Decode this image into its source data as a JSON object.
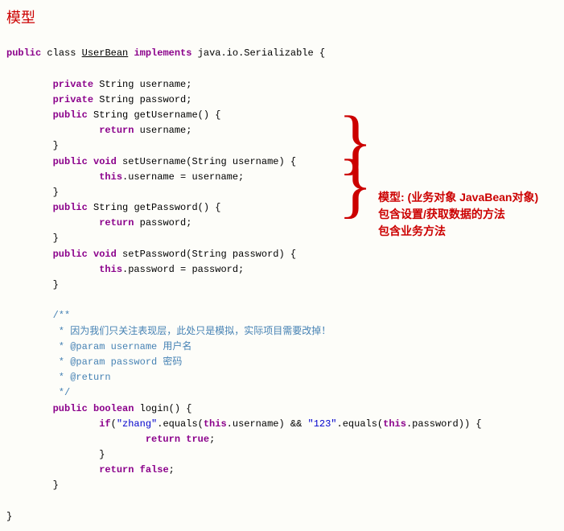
{
  "title": "模型",
  "code": {
    "l1a": "public",
    "l1b": " class ",
    "l1c": "UserBean",
    "l1d": " implements",
    "l1e": " java.io.Serializable {",
    "l2a": "private",
    "l2b": " String ",
    "l2c": "username",
    "l2d": ";",
    "l3a": "private",
    "l3b": " String ",
    "l3c": "password",
    "l3d": ";",
    "l4a": "public",
    "l4b": " String getUsername() {",
    "l5a": "return",
    "l5b": " username",
    "l5c": ";",
    "l6": "}",
    "l7a": "public",
    "l7b": " void",
    "l7c": " setUsername(String username) {",
    "l8a": "this",
    "l8b": ".",
    "l8c": "username",
    "l8d": " = username;",
    "l9": "}",
    "l10a": "public",
    "l10b": " String getPassword() {",
    "l11a": "return",
    "l11b": " password",
    "l11c": ";",
    "l12": "}",
    "l13a": "public",
    "l13b": " void",
    "l13c": " setPassword(String password) {",
    "l14a": "this",
    "l14b": ".",
    "l14c": "password",
    "l14d": " = password;",
    "l15": "}",
    "c1": "/**",
    "c2": " * 因为我们只关注表现层，此处只是模拟，实际项目需要改掉！",
    "c3": " * @param username 用户名",
    "c4": " * @param password 密码",
    "c5": " * @return",
    "c6": " */",
    "l16a": "public",
    "l16b": " boolean",
    "l16c": " login() {",
    "l17a": "if",
    "l17b": "(",
    "l17c": "\"zhang\"",
    "l17d": ".equals(",
    "l17e": "this",
    "l17f": ".",
    "l17g": "username",
    "l17h": ") && ",
    "l17i": "\"123\"",
    "l17j": ".equals(",
    "l17k": "this",
    "l17l": ".",
    "l17m": "password",
    "l17n": ")) {",
    "l18a": "return",
    "l18b": " true",
    "l18c": ";",
    "l19": "}",
    "l20a": "return",
    "l20b": " false",
    "l20c": ";",
    "l21": "}",
    "l22": "}"
  },
  "annotation": {
    "line1": "模型: (业务对象 JavaBean对象)",
    "line2": "包含设置/获取数据的方法",
    "line3": "包含业务方法"
  }
}
